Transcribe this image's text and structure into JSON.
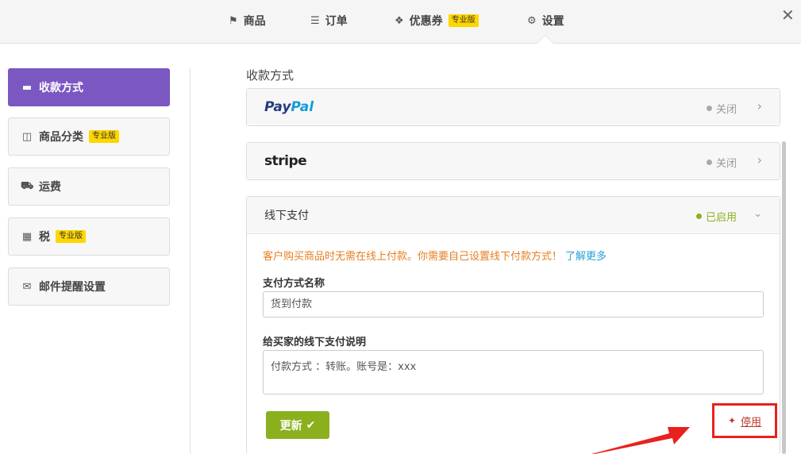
{
  "nav": {
    "products": "商品",
    "orders": "订单",
    "coupons": "优惠券",
    "coupons_badge": "专业版",
    "settings": "设置"
  },
  "sidebar": {
    "items": [
      {
        "label": "收款方式",
        "icon": "card-icon",
        "active": true
      },
      {
        "label": "商品分类",
        "icon": "folder-icon",
        "badge": "专业版"
      },
      {
        "label": "运费",
        "icon": "truck-icon"
      },
      {
        "label": "税",
        "icon": "calculator-icon",
        "badge": "专业版"
      },
      {
        "label": "邮件提醒设置",
        "icon": "envelope-icon"
      }
    ]
  },
  "main": {
    "section_title": "收款方式",
    "paypal": {
      "logo_a": "Pay",
      "logo_b": "Pal",
      "status": "关闭"
    },
    "stripe": {
      "logo": "stripe",
      "status": "关闭"
    },
    "offline": {
      "title": "线下支付",
      "status": "已启用",
      "notice": "客户购买商品时无需在线上付款。你需要自己设置线下付款方式！",
      "learn_more": "了解更多",
      "name_label": "支付方式名称",
      "name_value": "货到付款",
      "desc_label": "给买家的线下支付说明",
      "desc_value": "付款方式 ：转账。账号是：xxx",
      "update_label": "更新",
      "disable_label": "停用"
    }
  },
  "colors": {
    "accent_purple": "#7b57c2",
    "green": "#8bb01e",
    "badge_yellow": "#ffd600",
    "highlight_red": "#e8211d"
  }
}
